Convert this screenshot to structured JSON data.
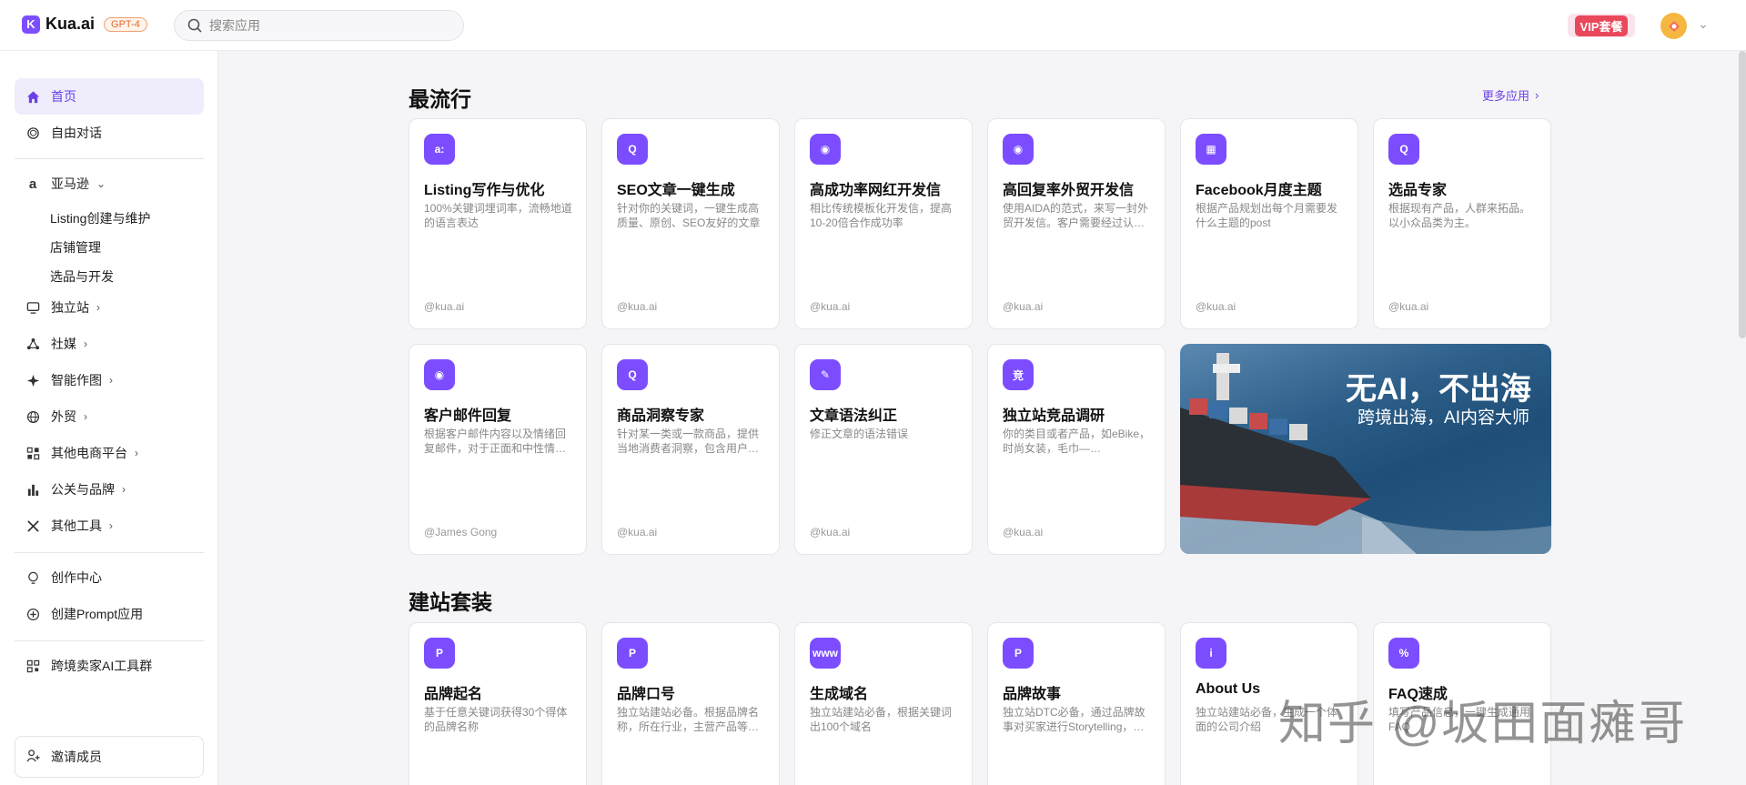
{
  "header": {
    "logo_mark": "K",
    "logo_text": "Kua.ai",
    "logo_badge": "GPT-4",
    "search_placeholder": "搜索应用",
    "vip_label": "VIP套餐"
  },
  "sidebar": {
    "items": [
      {
        "label": "首页",
        "icon": "home-icon"
      },
      {
        "label": "自由对话",
        "icon": "chat-icon"
      },
      {
        "label": "亚马逊",
        "icon": "amazon-icon"
      },
      {
        "label": "独立站",
        "icon": "monitor-icon"
      },
      {
        "label": "社媒",
        "icon": "share-icon"
      },
      {
        "label": "智能作图",
        "icon": "sparkle-icon"
      },
      {
        "label": "外贸",
        "icon": "globe-icon"
      },
      {
        "label": "其他电商平台",
        "icon": "grid-icon"
      },
      {
        "label": "公关与品牌",
        "icon": "chart-icon"
      },
      {
        "label": "其他工具",
        "icon": "tools-icon"
      },
      {
        "label": "创作中心",
        "icon": "bulb-icon"
      },
      {
        "label": "创建Prompt应用",
        "icon": "plus-circle-icon"
      },
      {
        "label": "跨境卖家AI工具群",
        "icon": "qrcode-icon"
      }
    ],
    "amazon_sub": [
      "Listing创建与维护",
      "店铺管理",
      "选品与开发"
    ],
    "invite_label": "邀请成员"
  },
  "main": {
    "popular_title": "最流行",
    "more_label": "更多应用",
    "popular_cards": [
      {
        "title": "Listing写作与优化",
        "desc": "100%关键词埋词率，流畅地道的语言表达",
        "author": "@kua.ai"
      },
      {
        "title": "SEO文章一键生成",
        "desc": "针对你的关键词，一键生成高质量、原创、SEO友好的文章",
        "author": "@kua.ai"
      },
      {
        "title": "高成功率网红开发信",
        "desc": "相比传统模板化开发信，提高10-20倍合作成功率",
        "author": "@kua.ai"
      },
      {
        "title": "高回复率外贸开发信",
        "desc": "使用AIDA的范式，来写一封外贸开发信。客户需要经过认…",
        "author": "@kua.ai"
      },
      {
        "title": "Facebook月度主题",
        "desc": "根据产品规划出每个月需要发什么主题的post",
        "author": "@kua.ai"
      },
      {
        "title": "选品专家",
        "desc": "根据现有产品，人群来拓品。以小众品类为主。",
        "author": "@kua.ai"
      },
      {
        "title": "客户邮件回复",
        "desc": "根据客户邮件内容以及情绪回复邮件，对于正面和中性情…",
        "author": "@James Gong"
      },
      {
        "title": "商品洞察专家",
        "desc": "针对某一类或一款商品，提供当地消费者洞察，包含用户…",
        "author": "@kua.ai"
      },
      {
        "title": "文章语法纠正",
        "desc": "修正文章的语法错误",
        "author": "@kua.ai"
      },
      {
        "title": "独立站竞品调研",
        "desc": "你的类目或者产品，如eBike，时尚女装，毛巾—…",
        "author": "@kua.ai"
      }
    ],
    "banner": {
      "line1": "无AI，不出海",
      "line2": "跨境出海，AI内容大师"
    },
    "build_title": "建站套装",
    "build_cards": [
      {
        "title": "品牌起名",
        "desc": "基于任意关键词获得30个得体的品牌名称"
      },
      {
        "title": "品牌口号",
        "desc": "独立站建站必备。根据品牌名称，所在行业，主营产品等…"
      },
      {
        "title": "生成域名",
        "desc": "独立站建站必备，根据关键词出100个域名"
      },
      {
        "title": "品牌故事",
        "desc": "独立站DTC必备，通过品牌故事对买家进行Storytelling，…"
      },
      {
        "title": "About Us",
        "desc": "独立站建站必备，生成一个体面的公司介绍"
      },
      {
        "title": "FAQ速成",
        "desc": "填写产品信息，一键生成通用FAQ"
      }
    ],
    "watermark": "知乎 @坂田面瘫哥"
  },
  "colors": {
    "accent": "#7c4dff",
    "vip": "#e9485a"
  }
}
